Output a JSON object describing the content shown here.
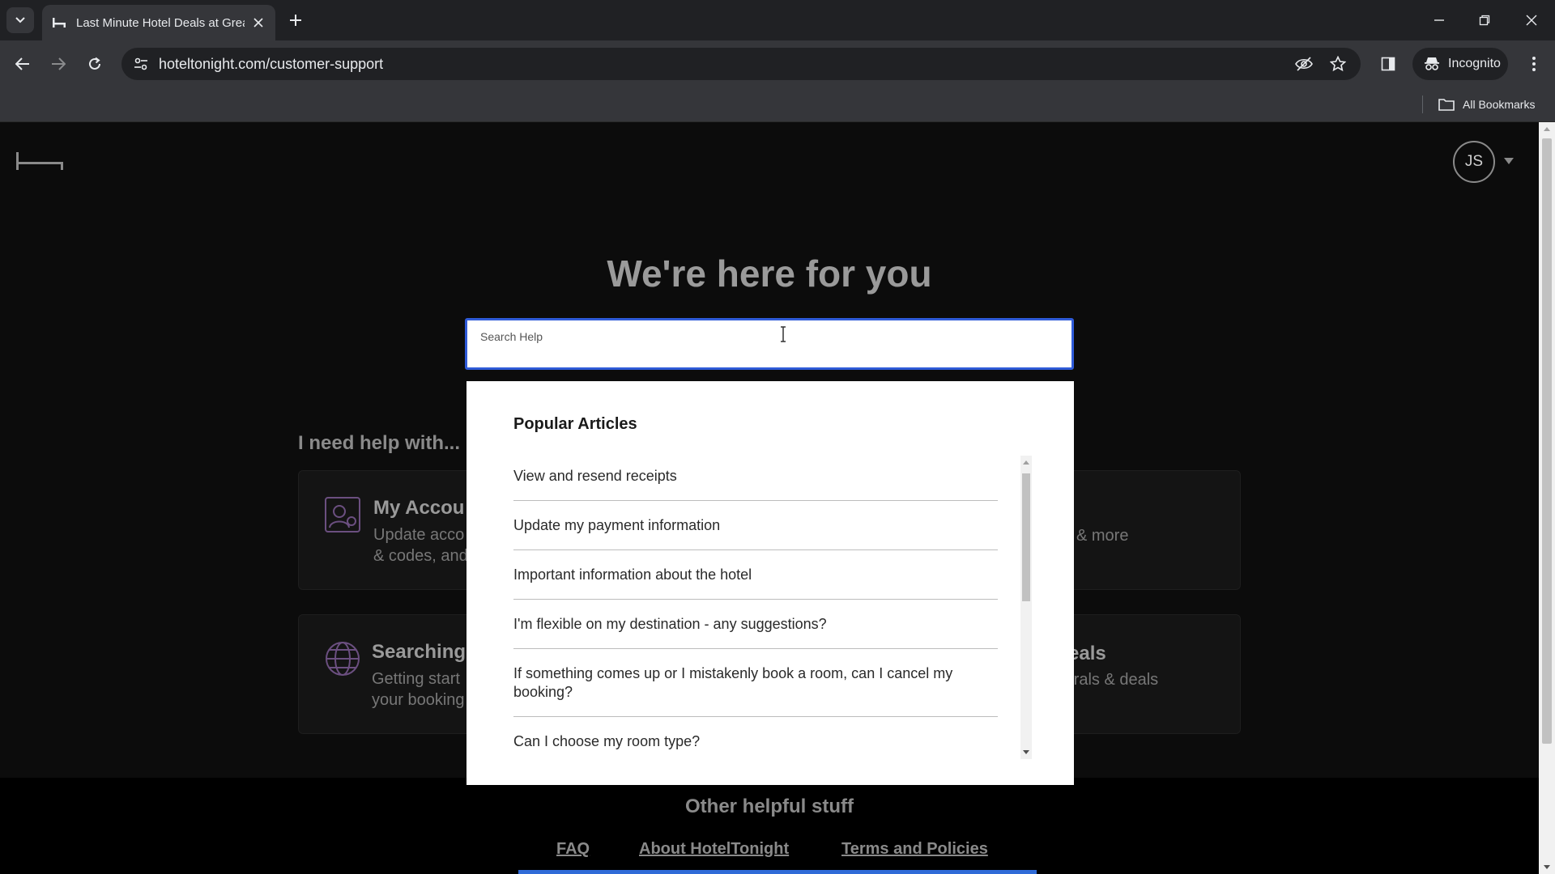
{
  "browser": {
    "tab_title": "Last Minute Hotel Deals at Grea",
    "url": "hoteltonight.com/customer-support",
    "incognito_label": "Incognito",
    "all_bookmarks_label": "All Bookmarks"
  },
  "page": {
    "avatar_initials": "JS",
    "hero_title": "We're here for you",
    "search": {
      "placeholder": "Search Help",
      "value": ""
    },
    "help_heading": "I need help with...",
    "cards": [
      {
        "title": "My Accou",
        "desc_line1": "Update acco",
        "desc_line2": "& codes, and"
      },
      {
        "title": "",
        "desc_line1": "& more",
        "desc_line2": ""
      },
      {
        "title": "Searching",
        "desc_line1": "Getting start",
        "desc_line2": "your booking"
      },
      {
        "title": "eals",
        "desc_line1": "rrals & deals",
        "desc_line2": ""
      }
    ],
    "other_title": "Other helpful stuff",
    "footer_links": [
      "FAQ",
      "About HotelTonight",
      "Terms and Policies"
    ]
  },
  "dropdown": {
    "title": "Popular Articles",
    "articles": [
      "View and resend receipts",
      "Update my payment information",
      "Important information about the hotel",
      "I'm flexible on my destination - any suggestions?",
      "If something comes up or I mistakenly book a room, can I cancel my booking?",
      "Can I choose my room type?"
    ]
  },
  "colors": {
    "accent_blue": "#2f5bd8",
    "page_bg": "#0c0c0c",
    "chrome_bg": "#35363a"
  }
}
